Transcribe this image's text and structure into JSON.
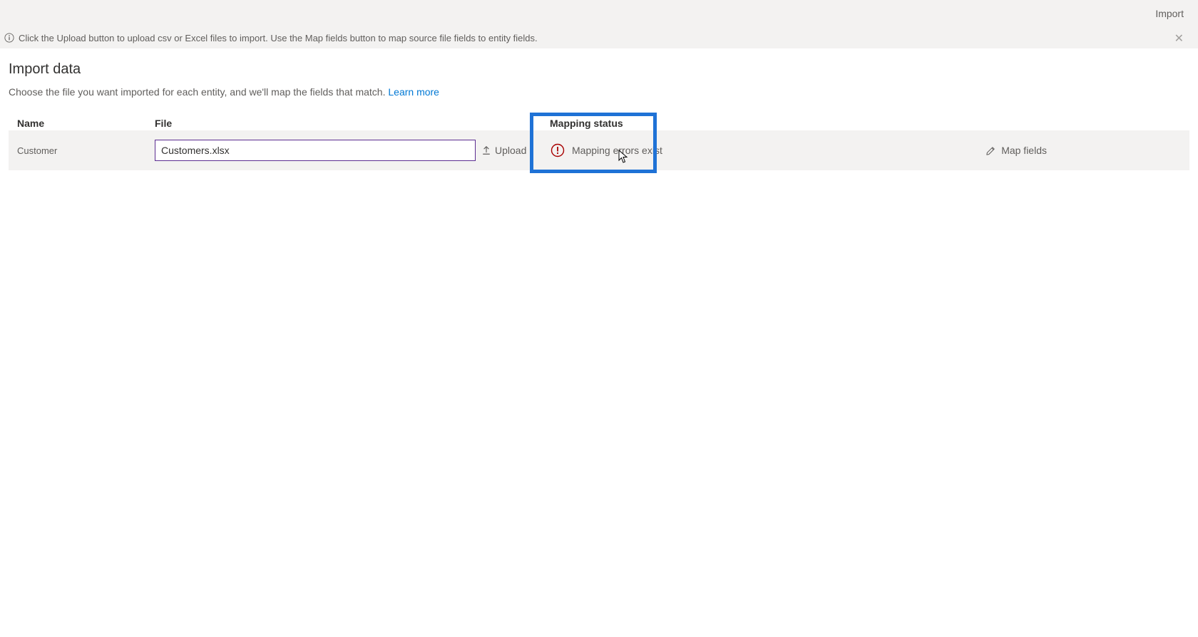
{
  "topbar": {
    "import_label": "Import"
  },
  "info_bar": {
    "text": "Click the Upload button to upload csv or Excel files to import. Use the Map fields button to map source file fields to entity fields."
  },
  "page": {
    "title": "Import data",
    "description": "Choose the file you want imported for each entity, and we'll map the fields that match. ",
    "learn_more": "Learn more"
  },
  "columns": {
    "name": "Name",
    "file": "File",
    "status": "Mapping status"
  },
  "row": {
    "entity_name": "Customer",
    "file_value": "Customers.xlsx",
    "upload_label": "Upload",
    "status_text": "Mapping errors exist",
    "map_fields_label": "Map fields"
  },
  "colors": {
    "accent": "#0078d4",
    "error": "#a80000",
    "highlight": "#1f72d6",
    "input_border": "#5c2d91"
  }
}
